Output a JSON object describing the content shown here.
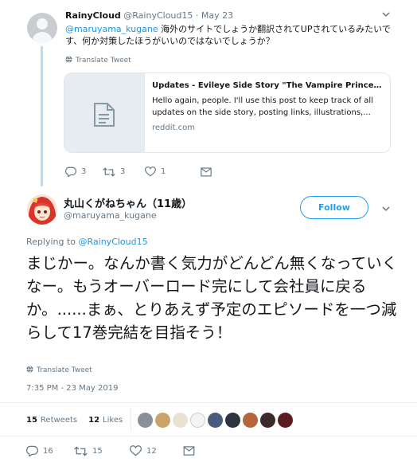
{
  "reply_tweet": {
    "author_name": "RainyCloud",
    "author_handle": "@RainyCloud15",
    "date": "May 23",
    "mention": "@maruyama_kugane",
    "text": " 海外のサイトでしょうか翻訳されてUPされているみたいです、何か対策したほうがいいのではないでしょうか？",
    "translate_label": "Translate Tweet",
    "card": {
      "title": "Updates - Evileye Side Story \"The Vampire Princess...",
      "description": "Hello again, people. I'll use this post to keep track of all updates on the side story, posting links, illustrations,...",
      "domain": "reddit.com"
    },
    "replies": "3",
    "retweets": "3",
    "likes": "1"
  },
  "main_tweet": {
    "author_name": "丸山くがねちゃん（11歳）",
    "author_handle": "@maruyama_kugane",
    "follow_label": "Follow",
    "replying_prefix": "Replying to ",
    "replying_to": "@RainyCloud15",
    "text": "まじかー。なんか書く気力がどんどん無くなっていくなー。もうオーバーロード完にして会社員に戻るか。......まぁ、とりあえず予定のエピソードを一つ減らして17巻完結を目指そう！",
    "translate_label": "Translate Tweet",
    "timestamp": "7:35 PM - 23 May 2019",
    "retweets_count": "15",
    "retweets_label": "Retweets",
    "likes_count": "12",
    "likes_label": "Likes",
    "replies": "16",
    "retweets": "15",
    "likes": "12"
  },
  "colors": {
    "link": "#1b95e0",
    "accent": "#1da1f2",
    "muted": "#657786"
  },
  "icons": [
    "chevron-down-icon",
    "globe-icon",
    "document-icon",
    "reply-icon",
    "retweet-icon",
    "like-icon",
    "message-icon"
  ]
}
